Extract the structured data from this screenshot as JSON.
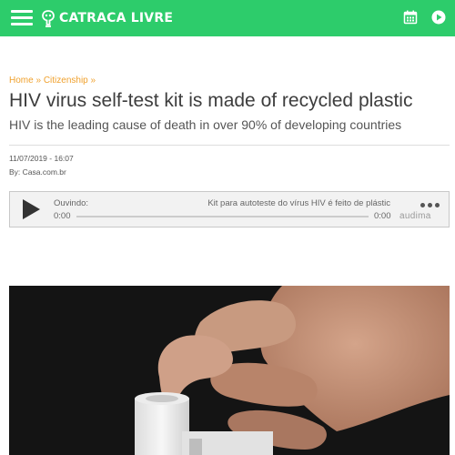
{
  "header": {
    "logo_text": "CATRACA LIVRE",
    "menu_icon": "hamburger-menu-icon",
    "calendar_icon": "calendar-icon",
    "play_icon": "play-circle-icon",
    "brand_color": "#2dcc6b"
  },
  "breadcrumb": {
    "home": "Home",
    "separator": "»",
    "section": "Citizenship"
  },
  "article": {
    "title": "HIV virus self-test kit is made of recycled plastic",
    "subtitle": "HIV is the leading cause of death in over 90% of developing countries",
    "date": "11/07/2019 - 16:07",
    "byline": "By: Casa.com.br"
  },
  "audio_player": {
    "now_playing_label": "Ouvindo:",
    "track_title": "Kit para autoteste do vírus HIV é feito de plástic",
    "current_time": "0:00",
    "duration": "0:00",
    "progress": 0,
    "brand": "audima"
  },
  "colors": {
    "accent": "#f0a12d",
    "title": "#3d3d3d"
  }
}
